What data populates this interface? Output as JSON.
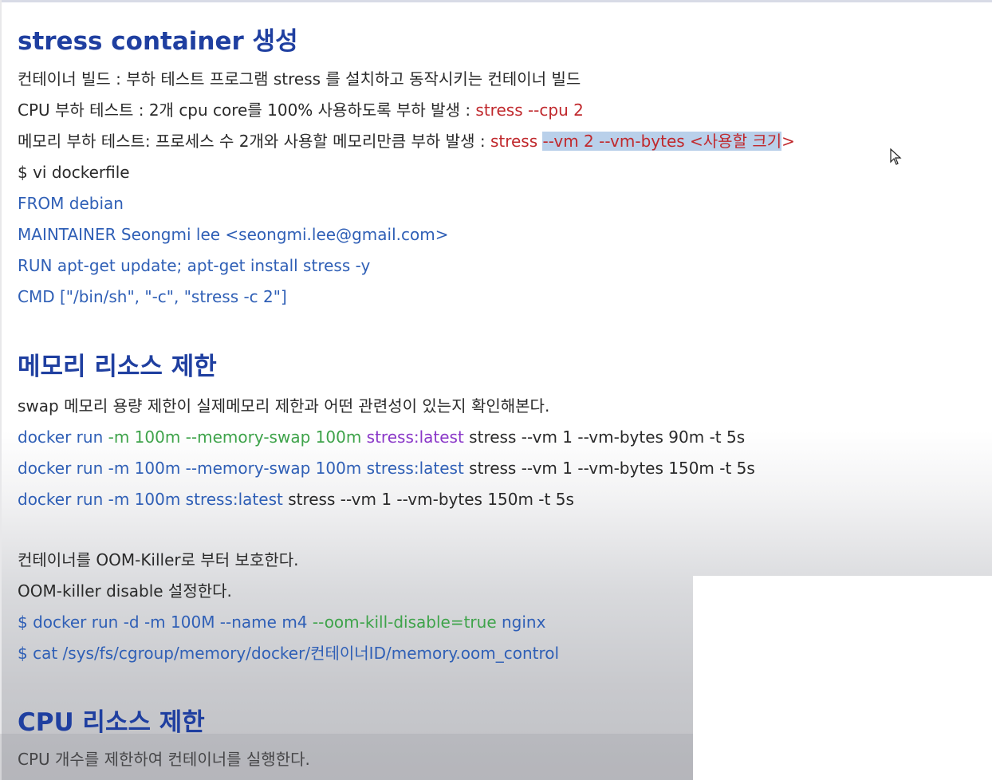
{
  "section1": {
    "heading": "stress container 생성",
    "l1": "컨테이너 빌드 : 부하 테스트 프로그램 stress 를 설치하고 동작시키는 컨테이너 빌드",
    "l2_text": "CPU 부하 테스트 : 2개 cpu core를 100% 사용하도록 부하 발생 : ",
    "l2_cmd": "stress --cpu 2",
    "l3_text": "메모리 부하 테스트: 프로세스 수 2개와 사용할 메모리만큼 부하 발생 : ",
    "l3_cmd": "stress ",
    "l3_selected": "--vm 2 --vm-bytes <사용할 크기",
    "l3_end": ">",
    "vi": "$ vi dockerfile",
    "dockerfile": [
      "FROM debian",
      "MAINTAINER Seongmi lee <seongmi.lee@gmail.com>",
      "RUN apt-get update; apt-get install stress -y",
      "CMD [\"/bin/sh\", \"-c\", \"stress -c 2\"]"
    ]
  },
  "section2": {
    "heading": "메모리 리소스 제한",
    "desc": "swap 메모리 용량 제한이 실제메모리 제한과 어떤 관련성이 있는지 확인해본다.",
    "cmd1": {
      "a": "docker run ",
      "b": "-m 100m  --memory-swap 100m ",
      "c": "stress:latest",
      "d": " stress --vm 1 --vm-bytes 90m -t 5s"
    },
    "cmd2": {
      "a": "docker run  -m 100m --memory-swap 100m stress:latest",
      "d": " stress --vm 1 --vm-bytes 150m -t 5s"
    },
    "cmd3": {
      "a": "docker run  -m 100m stress:latest",
      "d": " stress --vm 1 --vm-bytes 150m -t 5s"
    },
    "oom1": "컨테이너를 OOM-Killer로 부터 보호한다.",
    "oom2": "OOM-killer disable 설정한다.",
    "oom3": {
      "a": "$ docker run -d -m 100M --name m4 ",
      "b": "--oom-kill-disable=true",
      "c": " nginx"
    },
    "oom4": "$ cat /sys/fs/cgroup/memory/docker/컨테이너ID/memory.oom_control"
  },
  "section3": {
    "heading": "CPU 리소스 제한",
    "desc": "CPU 개수를 제한하여 컨테이너를 실행한다."
  },
  "colors": {
    "heading": "#1f3fa0",
    "code": "#2f5fb6",
    "red": "#c0282c",
    "green": "#3ea34a",
    "purple": "#8a37c8",
    "selection": "#b9d0ea"
  },
  "icons": {
    "cursor": "mouse-pointer-icon"
  }
}
